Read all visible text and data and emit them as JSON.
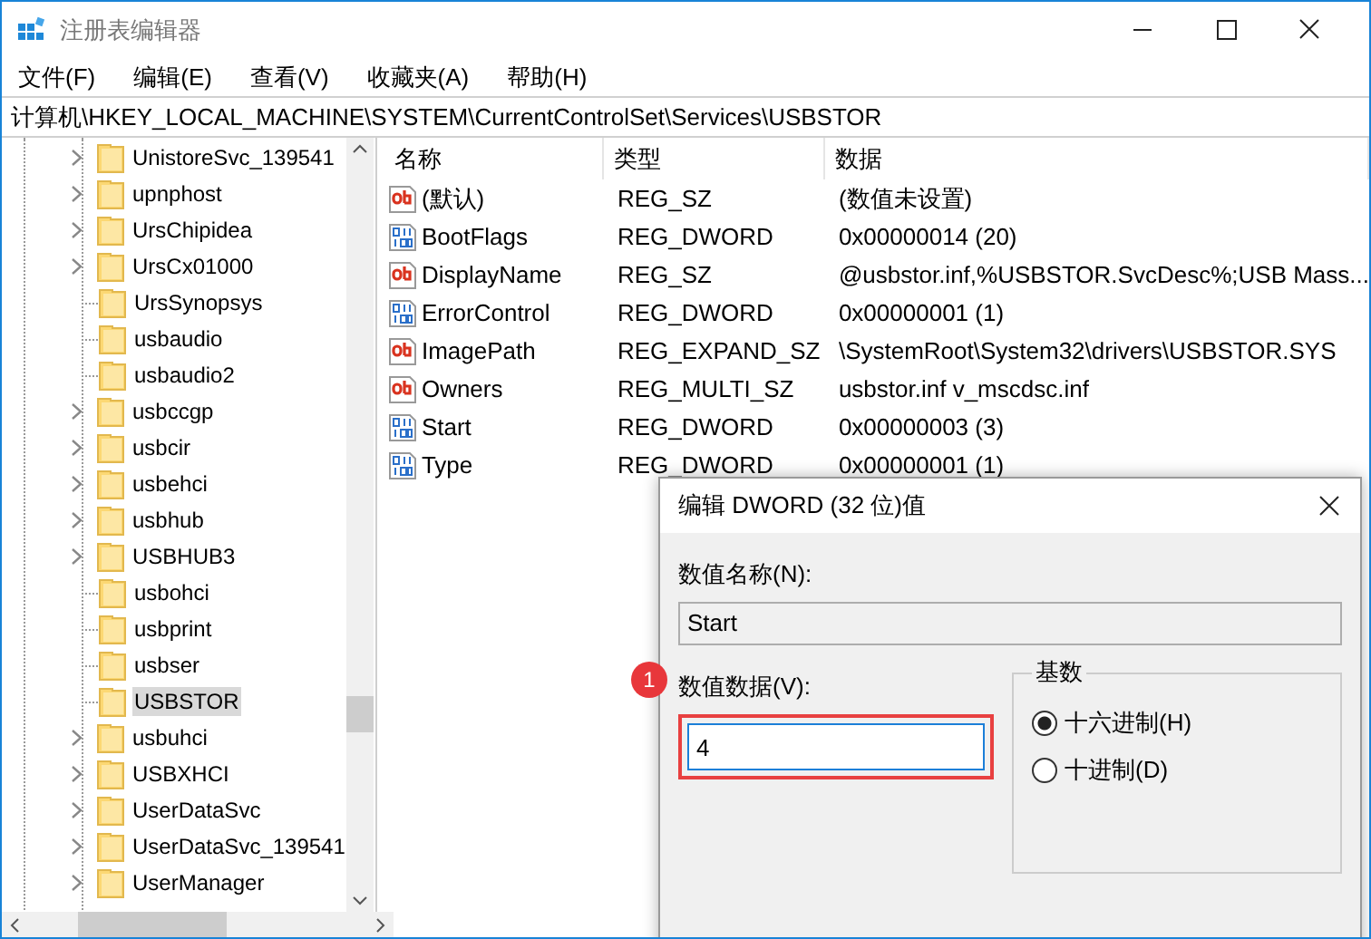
{
  "window": {
    "title": "注册表编辑器"
  },
  "menu": [
    "文件(F)",
    "编辑(E)",
    "查看(V)",
    "收藏夹(A)",
    "帮助(H)"
  ],
  "address": "计算机\\HKEY_LOCAL_MACHINE\\SYSTEM\\CurrentControlSet\\Services\\USBSTOR",
  "tree": [
    {
      "label": "UnistoreSvc_139541",
      "expandable": true,
      "selected": false
    },
    {
      "label": "upnphost",
      "expandable": true,
      "selected": false
    },
    {
      "label": "UrsChipidea",
      "expandable": true,
      "selected": false
    },
    {
      "label": "UrsCx01000",
      "expandable": true,
      "selected": false
    },
    {
      "label": "UrsSynopsys",
      "expandable": false,
      "selected": false
    },
    {
      "label": "usbaudio",
      "expandable": false,
      "selected": false
    },
    {
      "label": "usbaudio2",
      "expandable": false,
      "selected": false
    },
    {
      "label": "usbccgp",
      "expandable": true,
      "selected": false
    },
    {
      "label": "usbcir",
      "expandable": true,
      "selected": false
    },
    {
      "label": "usbehci",
      "expandable": true,
      "selected": false
    },
    {
      "label": "usbhub",
      "expandable": true,
      "selected": false
    },
    {
      "label": "USBHUB3",
      "expandable": true,
      "selected": false
    },
    {
      "label": "usbohci",
      "expandable": false,
      "selected": false
    },
    {
      "label": "usbprint",
      "expandable": false,
      "selected": false
    },
    {
      "label": "usbser",
      "expandable": false,
      "selected": false
    },
    {
      "label": "USBSTOR",
      "expandable": false,
      "selected": true
    },
    {
      "label": "usbuhci",
      "expandable": true,
      "selected": false
    },
    {
      "label": "USBXHCI",
      "expandable": true,
      "selected": false
    },
    {
      "label": "UserDataSvc",
      "expandable": true,
      "selected": false
    },
    {
      "label": "UserDataSvc_139541",
      "expandable": true,
      "selected": false
    },
    {
      "label": "UserManager",
      "expandable": true,
      "selected": false
    }
  ],
  "table": {
    "columns": [
      "名称",
      "类型",
      "数据"
    ],
    "rows": [
      {
        "kind": "string",
        "name": "(默认)",
        "type": "REG_SZ",
        "data": "(数值未设置)"
      },
      {
        "kind": "binary",
        "name": "BootFlags",
        "type": "REG_DWORD",
        "data": "0x00000014 (20)"
      },
      {
        "kind": "string",
        "name": "DisplayName",
        "type": "REG_SZ",
        "data": "@usbstor.inf,%USBSTOR.SvcDesc%;USB Mass..."
      },
      {
        "kind": "binary",
        "name": "ErrorControl",
        "type": "REG_DWORD",
        "data": "0x00000001 (1)"
      },
      {
        "kind": "string",
        "name": "ImagePath",
        "type": "REG_EXPAND_SZ",
        "data": "\\SystemRoot\\System32\\drivers\\USBSTOR.SYS"
      },
      {
        "kind": "string",
        "name": "Owners",
        "type": "REG_MULTI_SZ",
        "data": "usbstor.inf v_mscdsc.inf"
      },
      {
        "kind": "binary",
        "name": "Start",
        "type": "REG_DWORD",
        "data": "0x00000003 (3)"
      },
      {
        "kind": "binary",
        "name": "Type",
        "type": "REG_DWORD",
        "data": "0x00000001 (1)"
      }
    ]
  },
  "dialog": {
    "title": "编辑 DWORD (32 位)值",
    "name_label": "数值名称(N):",
    "name_value": "Start",
    "data_label": "数值数据(V):",
    "data_value": "4",
    "base_label": "基数",
    "radios": [
      {
        "label": "十六进制(H)",
        "selected": true
      },
      {
        "label": "十进制(D)",
        "selected": false
      }
    ],
    "step_marker": "1"
  }
}
